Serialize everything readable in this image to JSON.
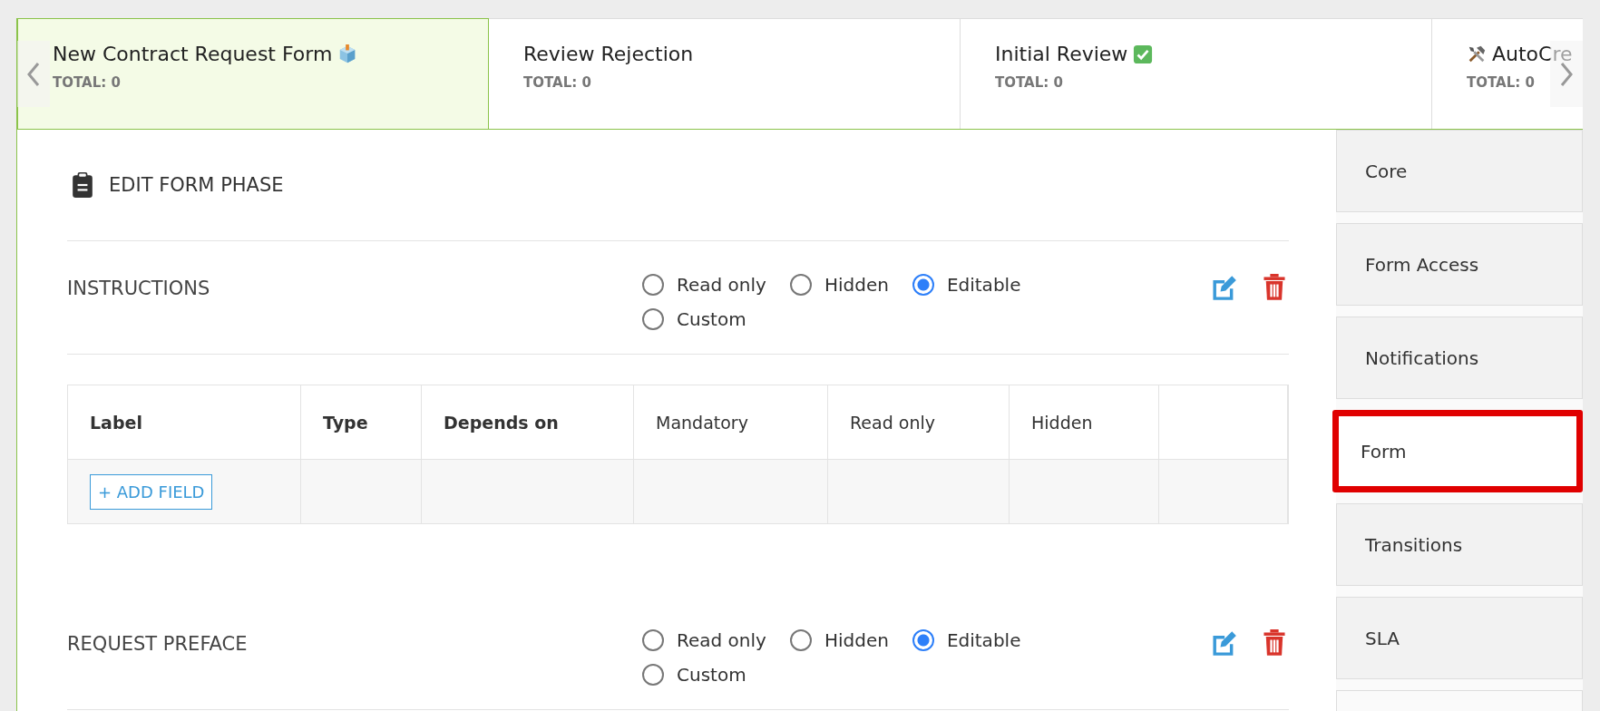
{
  "tabs": [
    {
      "title": "New Contract Request Form",
      "total": "TOTAL: 0",
      "selected": true
    },
    {
      "title": "Review Rejection",
      "total": "TOTAL: 0",
      "selected": false
    },
    {
      "title": "Initial Review",
      "total": "TOTAL: 0",
      "selected": false
    },
    {
      "title": "AutoCre",
      "total": "TOTAL: 0",
      "selected": false
    }
  ],
  "form_editor": {
    "heading": "EDIT FORM PHASE",
    "sections": [
      {
        "title": "INSTRUCTIONS",
        "options": [
          {
            "label": "Read only",
            "selected": false
          },
          {
            "label": "Hidden",
            "selected": false
          },
          {
            "label": "Editable",
            "selected": true
          },
          {
            "label": "Custom",
            "selected": false
          }
        ],
        "table": {
          "columns": [
            {
              "label": "Label",
              "kind": "field"
            },
            {
              "label": "Type",
              "kind": "field"
            },
            {
              "label": "Depends on",
              "kind": "field"
            },
            {
              "label": "Mandatory",
              "kind": "flag"
            },
            {
              "label": "Read only",
              "kind": "flag"
            },
            {
              "label": "Hidden",
              "kind": "flag"
            },
            {
              "kind": "actions"
            }
          ],
          "add_button": "+ ADD FIELD"
        }
      },
      {
        "title": "REQUEST PREFACE",
        "options": [
          {
            "label": "Read only",
            "selected": false
          },
          {
            "label": "Hidden",
            "selected": false
          },
          {
            "label": "Editable",
            "selected": true
          },
          {
            "label": "Custom",
            "selected": false
          }
        ]
      }
    ]
  },
  "sidebar": {
    "items": [
      {
        "label": "Core",
        "selected": false
      },
      {
        "label": "Form Access",
        "selected": false
      },
      {
        "label": "Notifications",
        "selected": false
      },
      {
        "label": "Form",
        "selected": true
      },
      {
        "label": "Transitions",
        "selected": false
      },
      {
        "label": "SLA",
        "selected": false
      }
    ]
  }
}
